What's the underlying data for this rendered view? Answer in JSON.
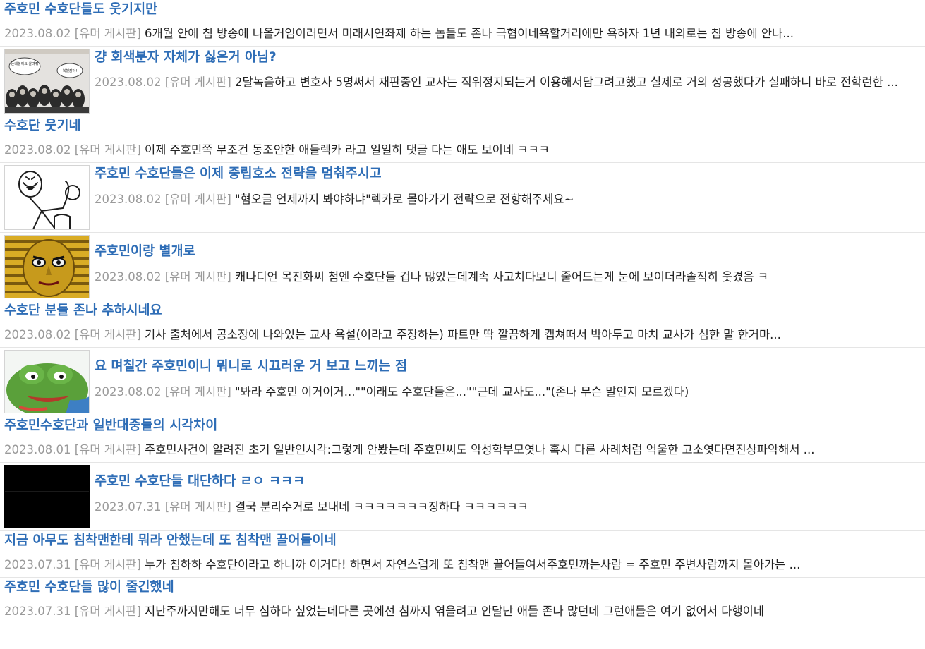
{
  "posts": [
    {
      "title": "주호민 수호단들도 웃기지만",
      "date": "2023.08.02",
      "board": "[유머 게시판]",
      "excerpt": "6개월 안에 침 방송에 나올거임이러면서 미래시연좌제 하는 놈들도 존나 극혐이네욕할거리에만 욕하자 1년 내외로는 침 방송에 안나..."
    },
    {
      "title": "걍 회색분자 자체가 싫은거 아님?",
      "date": "2023.08.02",
      "board": "[유머 게시판]",
      "excerpt": "2달녹음하고 변호사 5명써서 재판중인 교사는 직위정지되는거 이용해서담그려고했고 실제로 거의 성공했다가 실패하니 바로 전학런한 ...",
      "thumb": "comic-thumbnail"
    },
    {
      "title": "수호단 웃기네",
      "date": "2023.08.02",
      "board": "[유머 게시판]",
      "excerpt": "이제 주호민쪽 무조건 동조안한 애들렉카 라고 일일히 댓글 다는 애도 보이네 ㅋㅋㅋ"
    },
    {
      "title": "주호민 수호단들은 이제 중립호소 전략을 멈춰주시고",
      "date": "2023.08.02",
      "board": "[유머 게시판]",
      "excerpt": "\"혐오글 언제까지 봐야하냐\"렉카로 몰아가기 전략으로 전향해주세요~",
      "thumb": "stick-figure-thumbnail"
    },
    {
      "title": "주호민이랑 별개로",
      "date": "2023.08.02",
      "board": "[유머 게시판]",
      "excerpt": "캐나디언 목진화씨 첨엔 수호단들 겁나 많았는데계속 사고치다보니 줄어드는게 눈에 보이더라솔직히 웃겼음 ㅋ",
      "thumb": "golden-mask-thumbnail"
    },
    {
      "title": "수호단 분들 존나 추하시네요",
      "date": "2023.08.02",
      "board": "[유머 게시판]",
      "excerpt": "기사 출처에서 공소장에 나와있는 교사 욕설(이라고 주장하는) 파트만 딱 깔끔하게 캡쳐떠서 박아두고 마치 교사가 심한 말 한거마..."
    },
    {
      "title": "요 며칠간 주호민이니 뭐니로 시끄러운 거 보고 느끼는 점",
      "date": "2023.08.02",
      "board": "[유머 게시판]",
      "excerpt": "\"봐라 주호민 이거이거...\"\"이래도 수호단들은...\"\"근데 교사도...\"(존나 무슨 말인지 모르겠다)",
      "thumb": "pepe-frog-thumbnail"
    },
    {
      "title": "주호민수호단과 일반대중들의 시각차이",
      "date": "2023.08.01",
      "board": "[유머 게시판]",
      "excerpt": "주호민사건이 알려진 초기 일반인시각:그렇게 안봤는데 주호민씨도 악성학부모엿나 혹시 다른 사례처럼 억울한 고소엿다면진상파악해서 ..."
    },
    {
      "title": "주호민 수호단들 대단하다 ㄹㅇ ㅋㅋㅋ",
      "date": "2023.07.31",
      "board": "[유머 게시판]",
      "excerpt": "결국 분리수거로 보내네 ㅋㅋㅋㅋㅋㅋㅋ징하다 ㅋㅋㅋㅋㅋㅋ",
      "thumb": "black-thumbnail"
    },
    {
      "title": "지금 아무도 침착맨한테 뭐라 안했는데 또 침착맨 끌어들이네",
      "date": "2023.07.31",
      "board": "[유머 게시판]",
      "excerpt": "누가 침하하 수호단이라고 하니까 이거다! 하면서 자연스럽게 또 침착맨 끌어들여서주호민까는사람 = 주호민 주변사람까지 몰아가는 ..."
    },
    {
      "title": "주호민 수호단들 많이 줄긴했네",
      "date": "2023.07.31",
      "board": "[유머 게시판]",
      "excerpt": "지난주까지만해도 너무 심하다 싶었는데다른 곳에선 침까지 엮을려고 안달난 애들 존나 많던데 그런애들은 여기 없어서 다행이네"
    }
  ],
  "thumbnail_text": {
    "bubble_left": "돈내놓아요 살려줘",
    "bubble_right": "복했잖아!"
  },
  "colors": {
    "title": "#2e6db6",
    "meta": "#9a9a9a",
    "text": "#222222",
    "divider": "#e5e5e5"
  }
}
